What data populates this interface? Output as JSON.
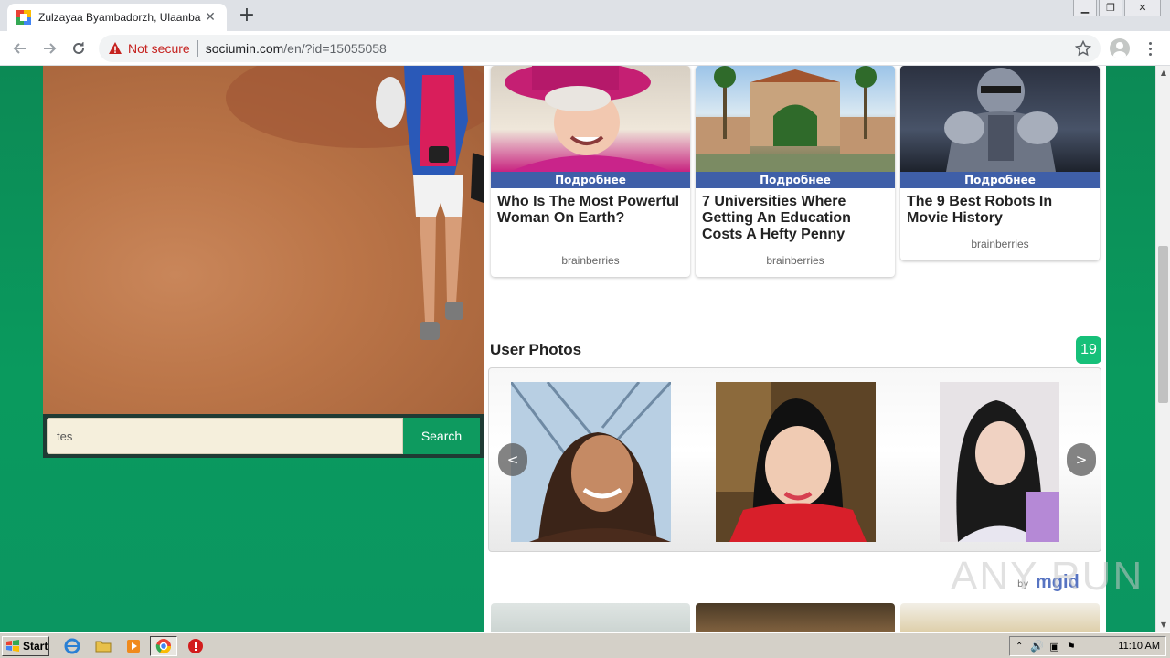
{
  "browser": {
    "tab_title": "Zulzayaa Byambadorzh, Ulaanbaatar",
    "security_label": "Not secure",
    "url_host": "sociumin.com",
    "url_path": "/en/?id=15055058"
  },
  "search": {
    "value": "tes",
    "button_label": "Search"
  },
  "recommendations": [
    {
      "badge": "Подробнее",
      "title": "Who Is The Most Powerful Woman On Earth?",
      "source": "brainberries"
    },
    {
      "badge": "Подробнее",
      "title": "7 Universities Where Getting An Education Costs A Hefty Penny",
      "source": "brainberries"
    },
    {
      "badge": "Подробнее",
      "title": "The 9 Best Robots In Movie History",
      "source": "brainberries"
    }
  ],
  "user_photos": {
    "title": "User Photos",
    "count": "19",
    "prev_label": "<",
    "next_label": ">"
  },
  "ad_network": {
    "by": "by",
    "logo": "mgid"
  },
  "watermark": "ANY RUN",
  "taskbar": {
    "start_label": "Start",
    "clock": "11:10 AM"
  },
  "colors": {
    "page_green": "#0c8a55",
    "badge_blue": "#3f5fa8",
    "count_green": "#16c079",
    "search_green": "#0e9a5f"
  },
  "icons": [
    "chrome-favicon",
    "close-icon",
    "plus-icon",
    "back-arrow-icon",
    "forward-arrow-icon",
    "reload-icon",
    "warning-triangle-icon",
    "star-icon",
    "profile-icon",
    "kebab-menu-icon",
    "ie-icon",
    "folder-icon",
    "media-player-icon",
    "chrome-icon",
    "opera-stop-icon",
    "speaker-icon",
    "network-icon",
    "flag-icon"
  ]
}
